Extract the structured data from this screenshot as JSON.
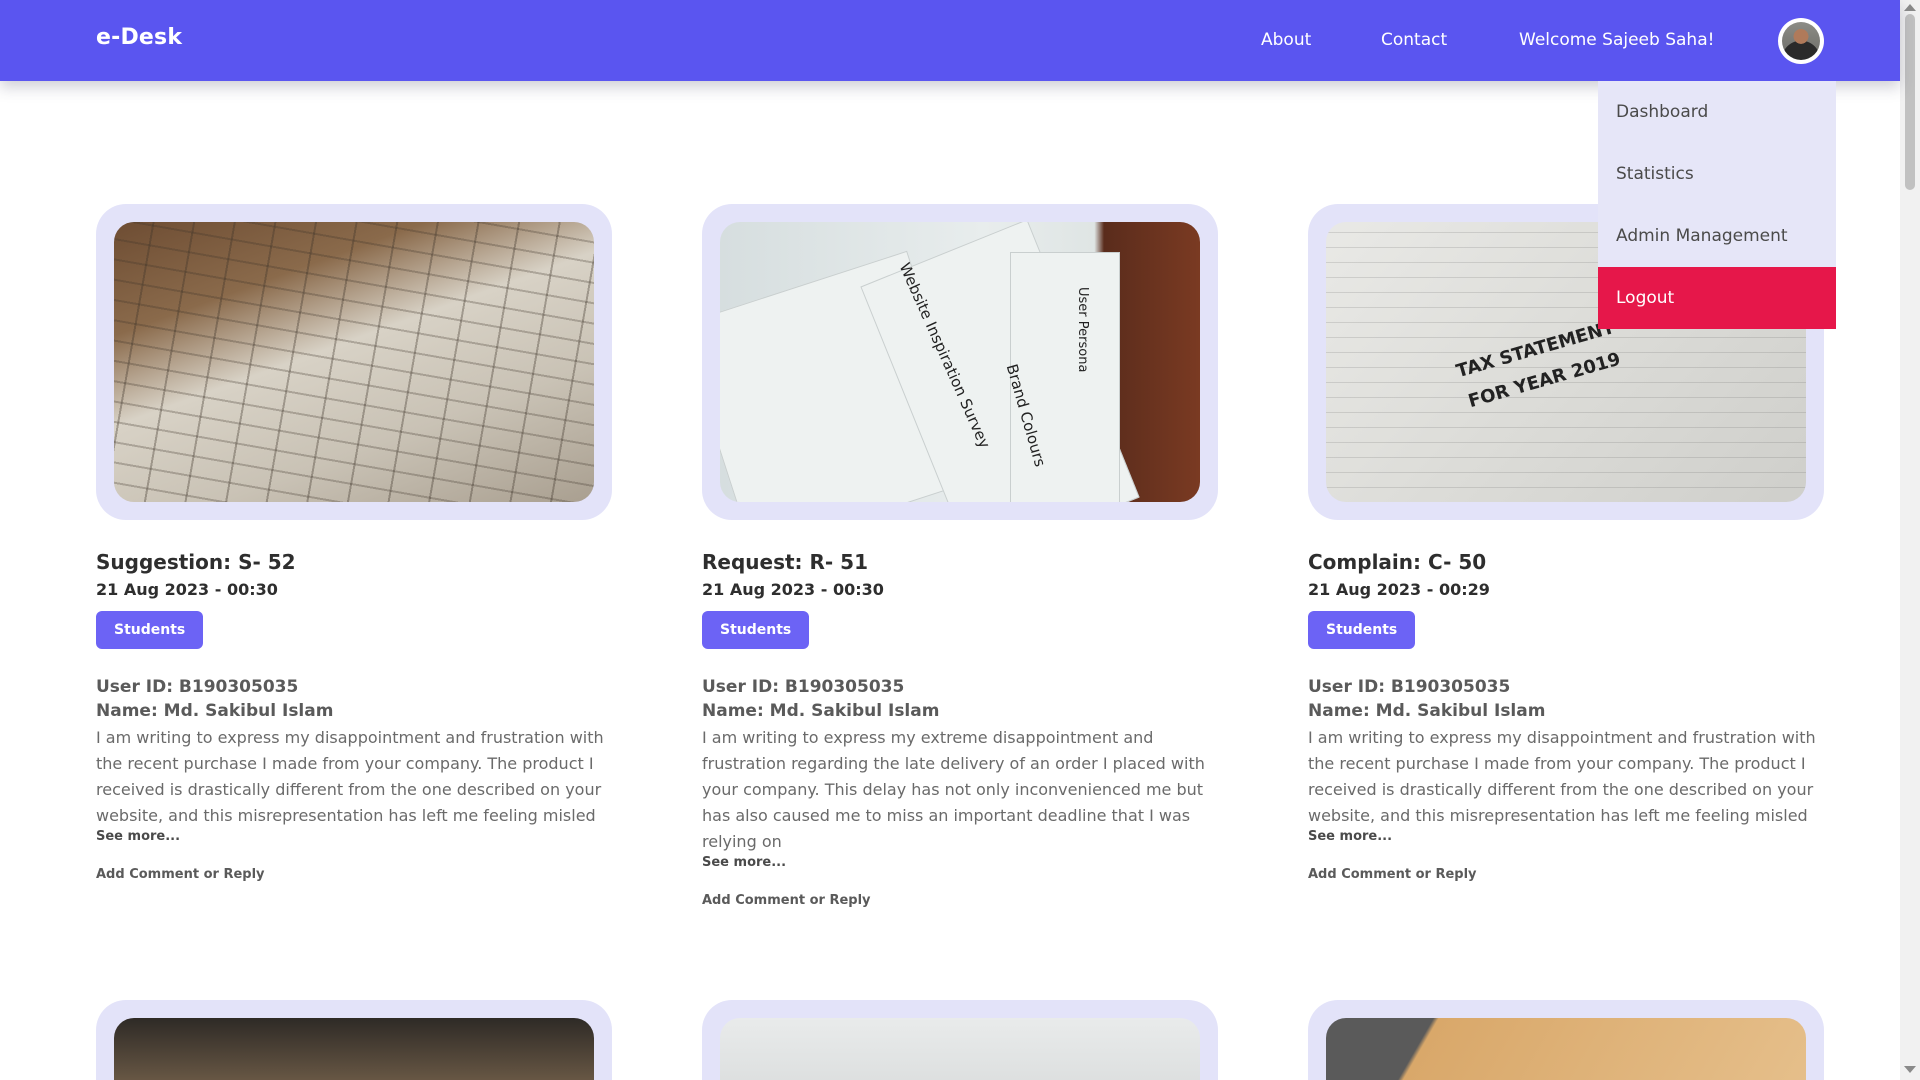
{
  "navbar": {
    "brand": "e-Desk",
    "links": {
      "about": "About",
      "contact": "Contact"
    },
    "welcome": "Welcome Sajeeb Saha!"
  },
  "dropdown": {
    "items": [
      "Dashboard",
      "Statistics",
      "Admin Management",
      "Logout"
    ]
  },
  "cards": [
    {
      "title": "Suggestion: S- 52",
      "date": "21 Aug 2023 - 00:30",
      "badge": "Students",
      "user_id": "User ID: B190305035",
      "name": "Name: Md. Sakibul Islam",
      "description": "I am writing to express my disappointment and frustration with the recent purchase I made from your company. The product I received is drastically different from the one described on your website, and this misrepresentation has left me feeling misled",
      "see_more": "See more...",
      "comment": "Add Comment or Reply"
    },
    {
      "title": "Request: R- 51",
      "date": "21 Aug 2023 - 00:30",
      "badge": "Students",
      "user_id": "User ID: B190305035",
      "name": "Name: Md. Sakibul Islam",
      "description": "I am writing to express my extreme disappointment and frustration regarding the late delivery of an order I placed with your company. This delay has not only inconvenienced me but has also caused me to miss an important deadline that I was relying on",
      "see_more": "See more...",
      "comment": "Add Comment or Reply",
      "image_labels": [
        "Website Inspiration Survey",
        "Brand Colours",
        "User Persona"
      ]
    },
    {
      "title": "Complain: C- 50",
      "date": "21 Aug 2023 - 00:29",
      "badge": "Students",
      "user_id": "User ID: B190305035",
      "name": "Name: Md. Sakibul Islam",
      "description": "I am writing to express my disappointment and frustration with the recent purchase I made from your company. The product I received is drastically different from the one described on your website, and this misrepresentation has left me feeling misled",
      "see_more": "See more...",
      "comment": "Add Comment or Reply",
      "image_labels": [
        "TAX STATEMENT",
        "FOR YEAR 2019"
      ]
    }
  ],
  "colors": {
    "navbar": "#5a55f0",
    "badge": "#6c63f5",
    "frame": "#e3e3f9",
    "logout": "#e6174a"
  }
}
